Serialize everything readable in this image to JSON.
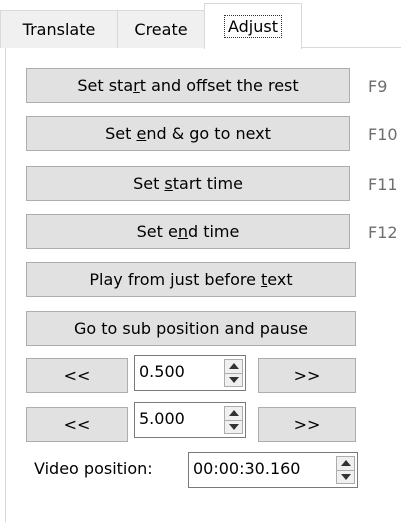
{
  "tabs": [
    {
      "label": "Translate",
      "active": false
    },
    {
      "label": "Create",
      "active": false
    },
    {
      "label": "Adjust",
      "active": true
    }
  ],
  "buttons": {
    "set_start_offset": {
      "pre": "Set sta",
      "acc": "r",
      "post": "t and offset the rest",
      "shortcut": "F9"
    },
    "set_end_next": {
      "pre": "Set ",
      "acc": "e",
      "post": "nd & go to next",
      "shortcut": "F10"
    },
    "set_start_time": {
      "pre": "Set ",
      "acc": "s",
      "post": "tart time",
      "shortcut": "F11"
    },
    "set_end_time": {
      "pre": "Set e",
      "acc": "n",
      "post": "d time",
      "shortcut": "F12"
    },
    "play_before_text": {
      "pre": "Play from just before ",
      "acc": "t",
      "post": "ext"
    },
    "goto_sub_pause": {
      "label": "Go to sub position and pause"
    }
  },
  "seek_rows": [
    {
      "back_label": "<<",
      "value": "0.500",
      "forward_label": ">>"
    },
    {
      "back_label": "<<",
      "value": "5.000",
      "forward_label": ">>"
    }
  ],
  "video_position": {
    "label": "Video position:",
    "value": "00:00:30.160"
  }
}
